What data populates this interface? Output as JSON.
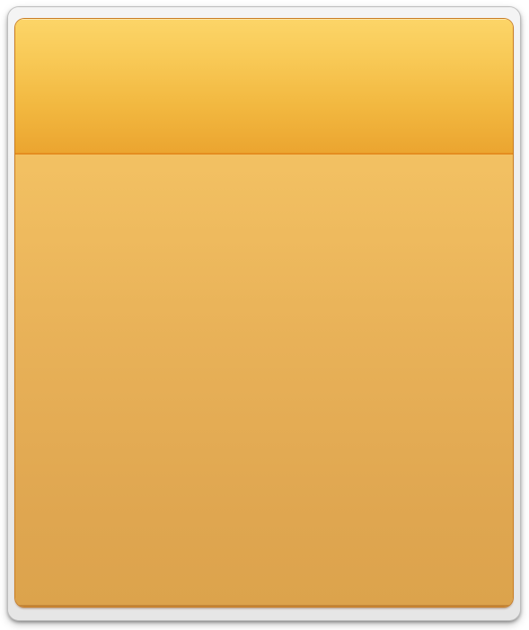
{
  "panel": {
    "title": "",
    "body_text": ""
  },
  "colors": {
    "frame": "#ececec",
    "header_top": "#fcd568",
    "header_bottom": "#eba530",
    "divider": "#e48d1f",
    "body_top": "#f9cf6e",
    "body_bottom": "#dca34c"
  }
}
